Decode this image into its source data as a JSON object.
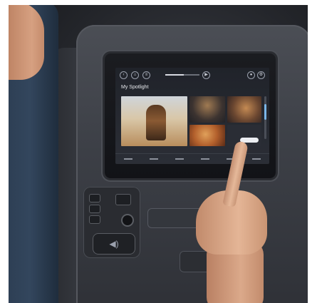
{
  "screen": {
    "section_title": "My Spotlight",
    "playback_progress_fraction": 0.55,
    "top_controls": [
      "back-icon",
      "home-icon",
      "menu-icon",
      "play-pause-icon"
    ],
    "right_controls": [
      "user-icon",
      "settings-icon"
    ],
    "scroll_position_fraction": 0.3
  },
  "seat": {
    "volume_glyph": "◀)"
  }
}
